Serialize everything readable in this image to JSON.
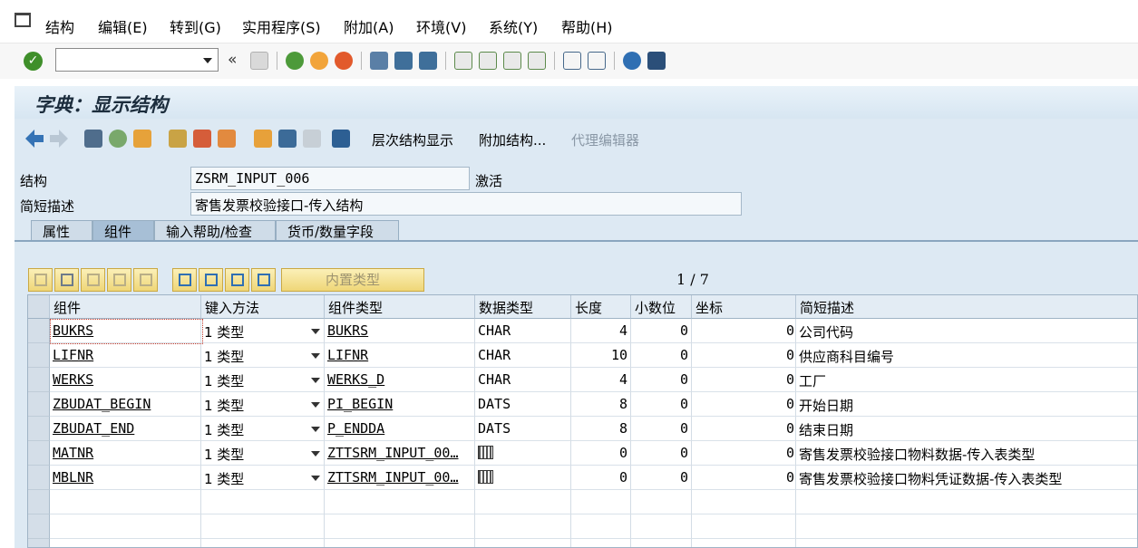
{
  "menu": [
    "结构",
    "编辑(E)",
    "转到(G)",
    "实用程序(S)",
    "附加(A)",
    "环境(V)",
    "系统(Y)",
    "帮助(H)"
  ],
  "title": "字典：显示结构",
  "app_toolbar": {
    "hierarchy_label": "层次结构显示",
    "append_label": "附加结构...",
    "proxy_label": "代理编辑器"
  },
  "fields": {
    "structure_label": "结构",
    "structure_value": "ZSRM_INPUT_006",
    "status": "激活",
    "desc_label": "简短描述",
    "desc_value": "寄售发票校验接口-传入结构"
  },
  "tabs": [
    "属性",
    "组件",
    "输入帮助/检查",
    "货币/数量字段"
  ],
  "active_tab": 1,
  "table_toolbar": {
    "builtin_type_label": "内置类型",
    "pager": "1 / 7"
  },
  "table": {
    "headers": [
      "组件",
      "键入方法",
      "组件类型",
      "数据类型",
      "长度",
      "小数位",
      "坐标",
      "简短描述"
    ],
    "rows": [
      {
        "component": "BUKRS",
        "typing": "1 类型",
        "comp_type": "BUKRS",
        "data_type": "CHAR",
        "length": "4",
        "decimals": "0",
        "coord": "0",
        "desc": "公司代码"
      },
      {
        "component": "LIFNR",
        "typing": "1 类型",
        "comp_type": "LIFNR",
        "data_type": "CHAR",
        "length": "10",
        "decimals": "0",
        "coord": "0",
        "desc": "供应商科目编号"
      },
      {
        "component": "WERKS",
        "typing": "1 类型",
        "comp_type": "WERKS_D",
        "data_type": "CHAR",
        "length": "4",
        "decimals": "0",
        "coord": "0",
        "desc": "工厂"
      },
      {
        "component": "ZBUDAT_BEGIN",
        "typing": "1 类型",
        "comp_type": "PI_BEGIN",
        "data_type": "DATS",
        "length": "8",
        "decimals": "0",
        "coord": "0",
        "desc": "开始日期"
      },
      {
        "component": "ZBUDAT_END",
        "typing": "1 类型",
        "comp_type": "P_ENDDA",
        "data_type": "DATS",
        "length": "8",
        "decimals": "0",
        "coord": "0",
        "desc": "结束日期"
      },
      {
        "component": "MATNR",
        "typing": "1 类型",
        "comp_type": "ZTTSRM_INPUT_00…",
        "data_type": "",
        "data_type_icon": "table-type-icon",
        "length": "0",
        "decimals": "0",
        "coord": "0",
        "desc": "寄售发票校验接口物料数据-传入表类型"
      },
      {
        "component": "MBLNR",
        "typing": "1 类型",
        "comp_type": "ZTTSRM_INPUT_00…",
        "data_type": "",
        "data_type_icon": "table-type-icon",
        "length": "0",
        "decimals": "0",
        "coord": "0",
        "desc": "寄售发票校验接口物料凭证数据-传入表类型"
      }
    ],
    "empty_rows": 3
  }
}
